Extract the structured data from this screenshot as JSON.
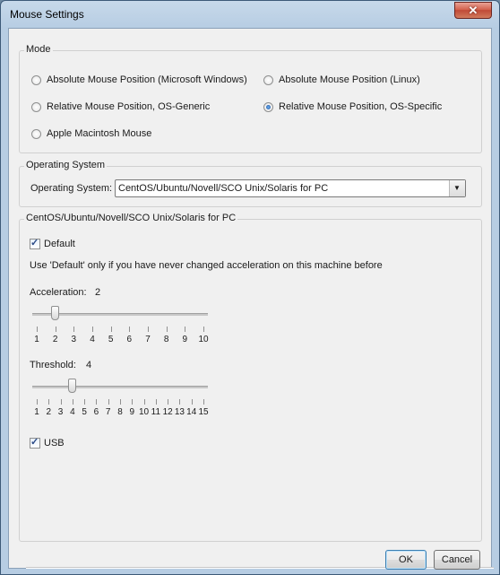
{
  "window": {
    "title": "Mouse Settings",
    "close_glyph": "✕"
  },
  "mode": {
    "legend": "Mode",
    "options": [
      {
        "label": "Absolute Mouse Position (Microsoft Windows)",
        "checked": false
      },
      {
        "label": "Absolute Mouse Position (Linux)",
        "checked": false
      },
      {
        "label": "Relative Mouse Position, OS-Generic",
        "checked": false
      },
      {
        "label": "Relative Mouse Position, OS-Specific",
        "checked": true
      },
      {
        "label": "Apple Macintosh Mouse",
        "checked": false
      }
    ]
  },
  "os": {
    "legend": "Operating System",
    "label": "Operating System:",
    "selected": "CentOS/Ubuntu/Novell/SCO Unix/Solaris for PC"
  },
  "settings": {
    "legend": "CentOS/Ubuntu/Novell/SCO Unix/Solaris for PC",
    "default_label": "Default",
    "default_checked": true,
    "hint": "Use 'Default' only if you have never changed acceleration on this machine before",
    "acceleration": {
      "label": "Acceleration:",
      "value": "2",
      "min": 1,
      "max": 10,
      "current": 2,
      "ticks": [
        "1",
        "2",
        "3",
        "4",
        "5",
        "6",
        "7",
        "8",
        "9",
        "10"
      ]
    },
    "threshold": {
      "label": "Threshold:",
      "value": "4",
      "min": 1,
      "max": 15,
      "current": 4,
      "ticks": [
        "1",
        "2",
        "3",
        "4",
        "5",
        "6",
        "7",
        "8",
        "9",
        "10",
        "11",
        "12",
        "13",
        "14",
        "15"
      ]
    },
    "usb_label": "USB",
    "usb_checked": true
  },
  "buttons": {
    "ok": "OK",
    "cancel": "Cancel"
  }
}
